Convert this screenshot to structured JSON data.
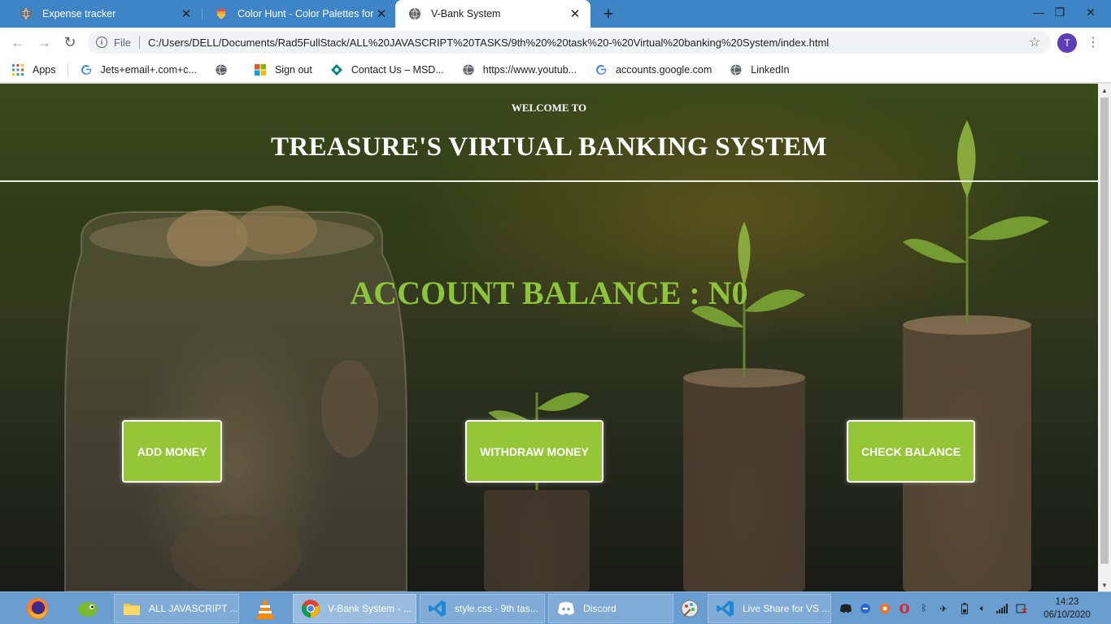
{
  "browser": {
    "tabs": [
      {
        "title": "Expense tracker",
        "icon": "globe-icon",
        "active": false
      },
      {
        "title": "Color Hunt - Color Palettes for D",
        "icon": "color-hunt-icon",
        "active": false
      },
      {
        "title": "V-Bank System",
        "icon": "globe-icon",
        "active": true
      }
    ],
    "address": {
      "scheme_label": "File",
      "url": "C:/Users/DELL/Documents/Rad5FullStack/ALL%20JAVASCRIPT%20TASKS/9th%20%20task%20-%20Virtual%20banking%20System/index.html"
    },
    "profile_initial": "T",
    "bookmarks": [
      {
        "label": "Apps",
        "icon": "apps-grid-icon"
      },
      {
        "label": "Jets+email+.com+c...",
        "icon": "google-icon"
      },
      {
        "label": "",
        "icon": "globe-icon"
      },
      {
        "label": "Sign out",
        "icon": "microsoft-icon"
      },
      {
        "label": "Contact Us – MSD...",
        "icon": "msd-icon"
      },
      {
        "label": "https://www.youtub...",
        "icon": "globe-icon"
      },
      {
        "label": "accounts.google.com",
        "icon": "google-icon"
      },
      {
        "label": "LinkedIn",
        "icon": "globe-icon"
      }
    ]
  },
  "page": {
    "welcome": "WELCOME TO",
    "title": "TREASURE'S VIRTUAL BANKING SYSTEM",
    "balance": "ACCOUNT BALANCE : N0",
    "buttons": {
      "add": "ADD MONEY",
      "withdraw": "WITHDRAW MONEY",
      "check": "CHECK BALANCE"
    },
    "accent_color": "#94c637",
    "balance_color": "#8cc43a"
  },
  "taskbar": {
    "pinned": [
      "firefox-icon",
      "chameleon-icon"
    ],
    "apps": [
      {
        "label": "ALL JAVASCRIPT ...",
        "icon": "folder-icon"
      },
      {
        "label": "",
        "icon": "vlc-icon"
      },
      {
        "label": "V-Bank System - ...",
        "icon": "chrome-icon",
        "active": true
      },
      {
        "label": "style.css - 9th tas...",
        "icon": "vscode-icon"
      },
      {
        "label": "Discord",
        "icon": "discord-icon"
      },
      {
        "label": "",
        "icon": "paint-icon"
      },
      {
        "label": "Live Share for VS ...",
        "icon": "vscode-icon"
      }
    ],
    "clock": {
      "time": "14:23",
      "date": "06/10/2020"
    }
  }
}
